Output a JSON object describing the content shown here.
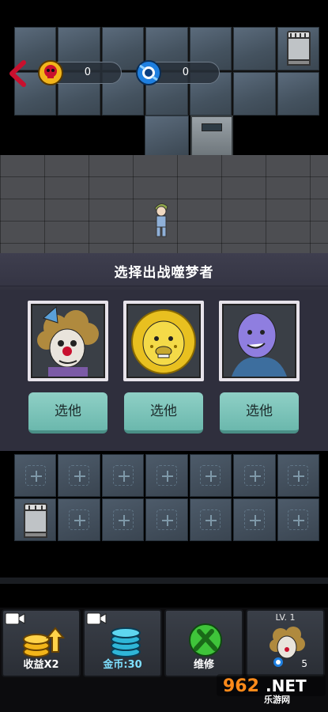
{
  "header": {
    "currencies": [
      {
        "icon": "skull-coin-icon",
        "value": "0",
        "color": "#f2b51a"
      },
      {
        "icon": "blue-gem-icon",
        "value": "0",
        "color": "#1e7fe0"
      }
    ]
  },
  "selection": {
    "title": "选择出战噬梦者",
    "candidates": [
      {
        "name": "clown-portrait",
        "button": "选他"
      },
      {
        "name": "lion-portrait",
        "button": "选他"
      },
      {
        "name": "bald-man-portrait",
        "button": "选他"
      }
    ]
  },
  "bottom_bar": {
    "buttons": [
      {
        "label": "收益X2",
        "icon": "gold-coins-up-icon",
        "has_video": true
      },
      {
        "label": "金币:30",
        "icon": "blue-coins-icon",
        "has_video": true
      },
      {
        "label": "维修",
        "icon": "wrench-icon",
        "has_video": false
      },
      {
        "level": "LV. 1",
        "count": "5",
        "icon": "clown-avatar-icon"
      }
    ]
  },
  "watermark": {
    "logo": "962.NET",
    "text": "乐游网"
  },
  "colors": {
    "panel": "#32323f",
    "pick_button": "#7cc4b9",
    "accent_red": "#c8102e"
  }
}
